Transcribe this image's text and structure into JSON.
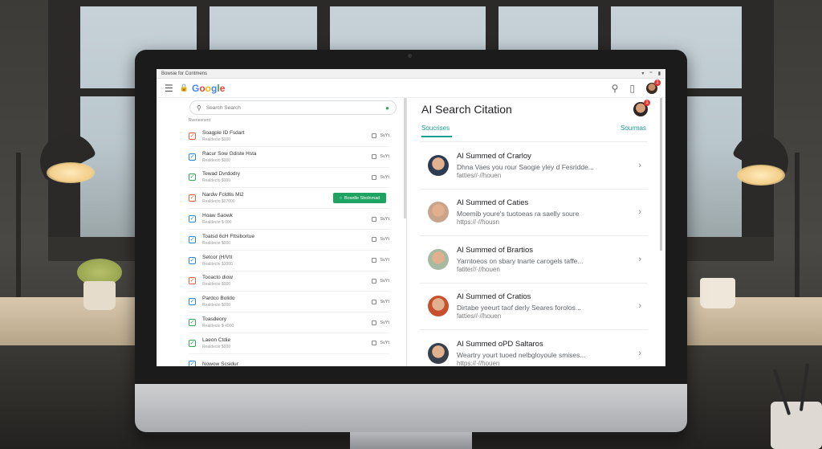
{
  "os_bar": {
    "title": "Bowsie for Contmens"
  },
  "app": {
    "logo": "Google",
    "notification_count": "1"
  },
  "left": {
    "search_placeholder": "Search Search",
    "section_label": "Rveneenent",
    "rows": [
      {
        "title": "Soagple ID Fsdart",
        "sub": "Realdecte $000",
        "action": "SvYt",
        "check": "orange"
      },
      {
        "title": "Racur Sow Gdiste Hsta",
        "sub": "Realdecto $000",
        "action": "SvYt",
        "check": "blue"
      },
      {
        "title": "Tewad Dvrdodry",
        "sub": "Realdecto $000",
        "action": "SvYt",
        "check": "green"
      },
      {
        "title": "Nardw Fcldtis Mi2",
        "sub": "Realdecto $07000",
        "action": "Bowdle Sbolnmad",
        "check": "orange",
        "highlight": true
      },
      {
        "title": "Hoaw Saowk",
        "sub": "Realdecte $ 000",
        "action": "SvYt",
        "check": "blue"
      },
      {
        "title": "Toatsd 6cH Fttsibortue",
        "sub": "Realdecte $000",
        "action": "SvYt",
        "check": "blue"
      },
      {
        "title": "Setcor (H/VtI",
        "sub": "Realdecte $3000",
        "action": "SvYt",
        "check": "blue"
      },
      {
        "title": "Tooacto diow",
        "sub": "Realdecte $000",
        "action": "SvYt",
        "check": "orange"
      },
      {
        "title": "Pardco Bolido",
        "sub": "Realdecte $000",
        "action": "SvYt",
        "check": "blue"
      },
      {
        "title": "Toasdeory",
        "sub": "Realdecte $ 4000",
        "action": "SvYt",
        "check": "green"
      },
      {
        "title": "Laeon Ctdie",
        "sub": "Realdecte $000",
        "action": "SvYt",
        "check": "green"
      },
      {
        "title": "Nowow Scsidur",
        "sub": "",
        "action": "",
        "check": "blue"
      }
    ]
  },
  "right": {
    "title": "AI Search Citation",
    "tab_left": "Soucrises",
    "tab_right": "Sourmas",
    "cards": [
      {
        "title": "Al Summed of Crarloy",
        "snippet": "Dhna Vaes you rour Saogie yley d Fesridde...",
        "url": "fatties//·//houen",
        "avatar_color": "#2d3b52"
      },
      {
        "title": "Al Summed of Caties",
        "snippet": "Moemib youre's tuotoeas ra saelly soure",
        "url": "https://·//housn",
        "avatar_color": "#c9a48a"
      },
      {
        "title": "Al Summed of Brartios",
        "snippet": "Yarntoeos on sbary tnarte carogels taffe...",
        "url": "fatiter//·//houen",
        "avatar_color": "#a7b9a0"
      },
      {
        "title": "Al Summed of Cratios",
        "snippet": "Dirtabe yeeurt taof derly Seares forolos...",
        "url": "fatties//·//houen",
        "avatar_color": "#c8502c"
      },
      {
        "title": "Al Summed oPD Saltaros",
        "snippet": "Weartry yourt tuoed nelbgloyoule smises...",
        "url": "https://·//houen",
        "avatar_color": "#37404a"
      }
    ]
  },
  "colors": {
    "accent": "#1a9c8e",
    "action_green": "#1ea362",
    "notification": "#e53935"
  },
  "icons": {
    "menu": "menu-icon",
    "lock": "lock-icon",
    "search": "search-icon",
    "bookmark": "bookmark-icon",
    "mic": "mic-icon",
    "chevron": "chevron-right-icon",
    "checkbox": "checkbox-icon"
  }
}
